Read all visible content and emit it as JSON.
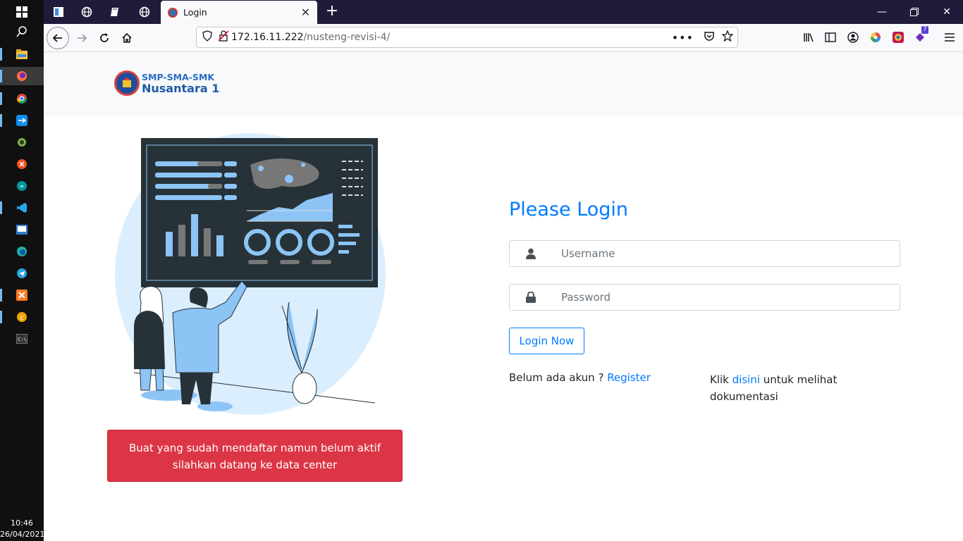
{
  "taskbar": {
    "clock_time": "10:46",
    "clock_date": "26/04/2021"
  },
  "browser": {
    "active_tab_title": "Login",
    "url_host": "172.16.11.222",
    "url_path": "/nusteng-revisi-4/",
    "extensions_badge": "7"
  },
  "header": {
    "logo_line1": "SMP-SMA-SMK",
    "logo_line2": "Nusantara 1"
  },
  "alert": {
    "text": "Buat yang sudah mendaftar namun belum aktif silahkan datang ke data center"
  },
  "login": {
    "title": "Please Login",
    "username_placeholder": "Username",
    "password_placeholder": "Password",
    "submit_label": "Login Now",
    "register_prefix": "Belum ada akun ? ",
    "register_link": "Register",
    "docs_prefix": "Klik ",
    "docs_link": "disini",
    "docs_suffix": " untuk melihat dokumentasi"
  },
  "colors": {
    "primary": "#007bff",
    "danger": "#dc3545",
    "tabstrip": "#1f1c3b",
    "illustration_blue": "#8cc4f5"
  },
  "icons": {
    "username": "user-icon",
    "password": "lock-icon"
  }
}
